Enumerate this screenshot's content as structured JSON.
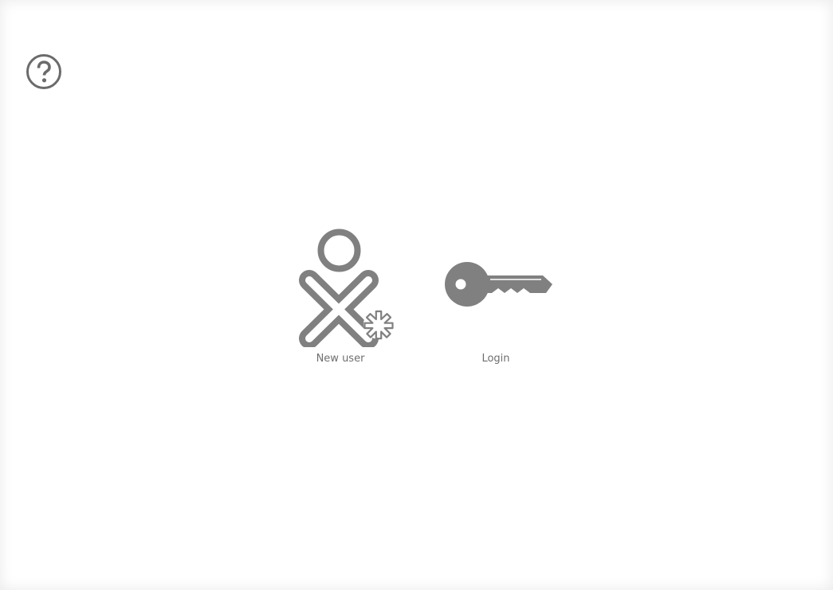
{
  "window": {
    "help": {
      "icon": "help-circle-icon"
    }
  },
  "options": {
    "new_user": {
      "label": "New user",
      "icon": "xo-person-new-icon"
    },
    "login": {
      "label": "Login",
      "icon": "key-icon"
    }
  },
  "colors": {
    "icon_gray": "#808080",
    "label_gray": "#6e6e6e",
    "background": "#ffffff"
  }
}
